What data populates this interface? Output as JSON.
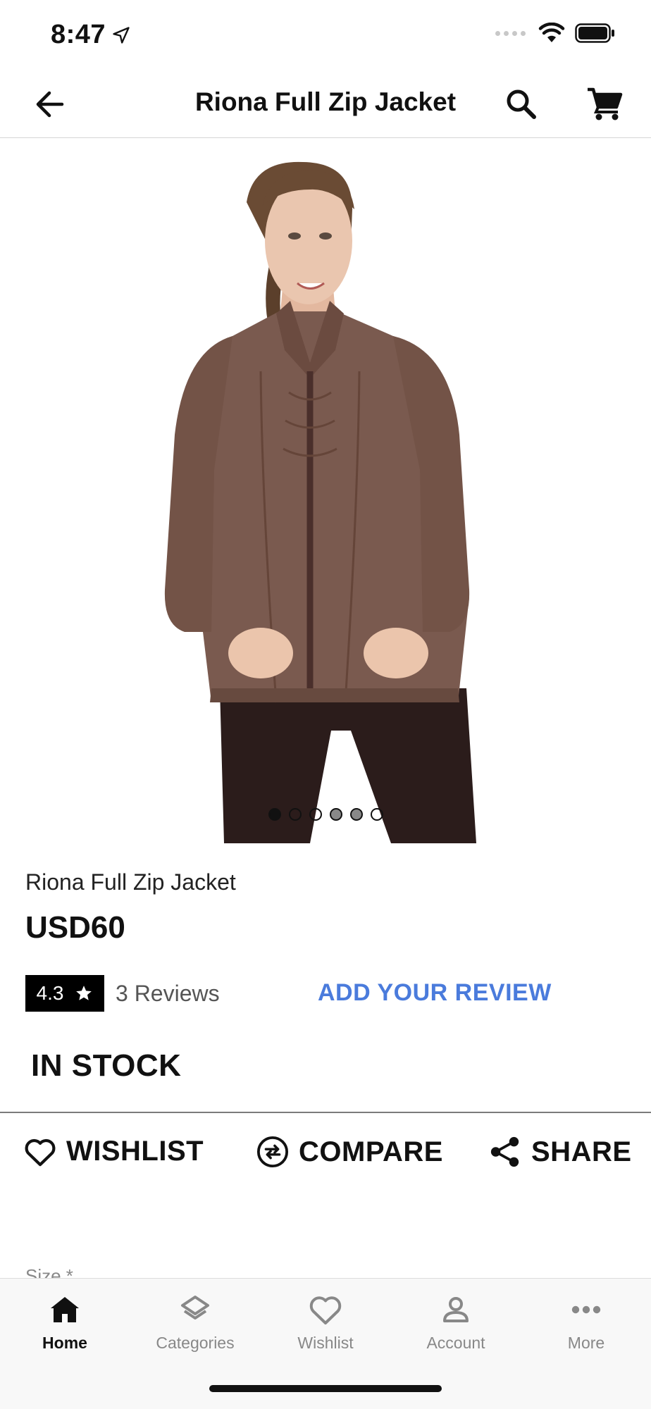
{
  "status_bar": {
    "time": "8:47"
  },
  "nav": {
    "title": "Riona Full Zip Jacket"
  },
  "carousel": {
    "total_images": 6,
    "active_index": 0
  },
  "product": {
    "name": "Riona Full Zip Jacket",
    "price": "USD60",
    "rating": "4.3",
    "reviews": "3 Reviews",
    "add_review_label": "ADD YOUR REVIEW",
    "stock": "IN STOCK",
    "image_colors": {
      "jacket": "#7a5a4f",
      "leggings": "#2b1c1b",
      "skin": "#e6c0a8",
      "hair": "#6a4b34"
    }
  },
  "actions": {
    "wishlist_label": "WISHLIST",
    "compare_label": "COMPARE",
    "share_label": "SHARE"
  },
  "options": {
    "size_label": "Size *"
  },
  "tabs": [
    {
      "label": "Home",
      "icon": "home-icon",
      "active": true
    },
    {
      "label": "Categories",
      "icon": "layers-icon",
      "active": false
    },
    {
      "label": "Wishlist",
      "icon": "heart-icon",
      "active": false
    },
    {
      "label": "Account",
      "icon": "person-icon",
      "active": false
    },
    {
      "label": "More",
      "icon": "more-dots-icon",
      "active": false
    }
  ],
  "colors": {
    "accent": "#4a7bdc",
    "text": "#111111",
    "muted": "#888888"
  }
}
